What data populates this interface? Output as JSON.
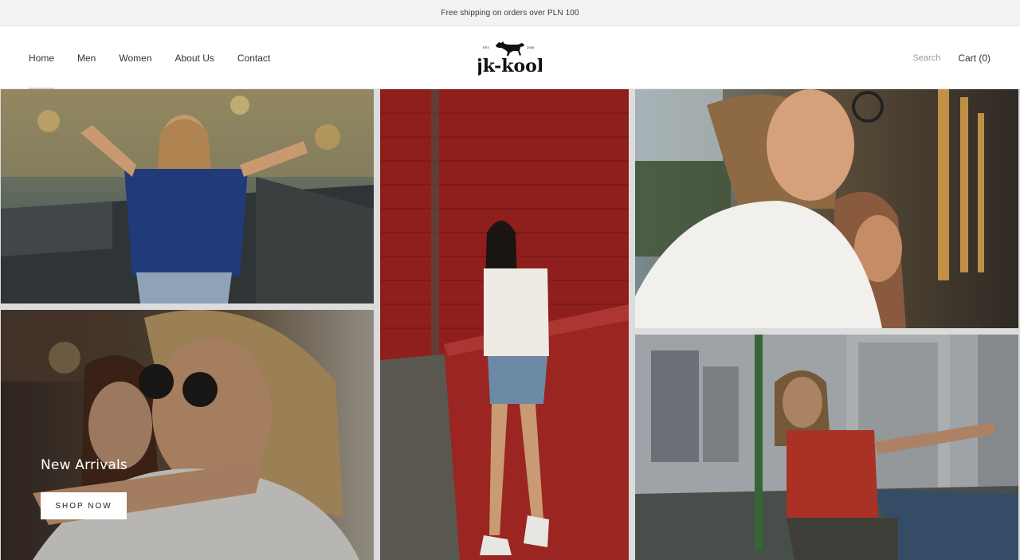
{
  "announcement": {
    "text": "Free shipping on orders over PLN 100"
  },
  "header": {
    "nav": [
      {
        "label": "Home",
        "active": true
      },
      {
        "label": "Men"
      },
      {
        "label": "Women"
      },
      {
        "label": "About Us"
      },
      {
        "label": "Contact"
      }
    ],
    "logo": {
      "est": "EST.",
      "year": "2008",
      "wordmark": "jk-kool",
      "icon": "dog-icon"
    },
    "search_label": "Search",
    "cart_label": "Cart (0)"
  },
  "hero": {
    "title": "New Arrivals",
    "button_label": "SHOP NOW"
  },
  "colors": {
    "brand_text": "#1e1e1e",
    "muted_text": "#9a9a9a",
    "announcement_bg": "#f3f3f3",
    "brick_red": "#8f1f1c"
  }
}
